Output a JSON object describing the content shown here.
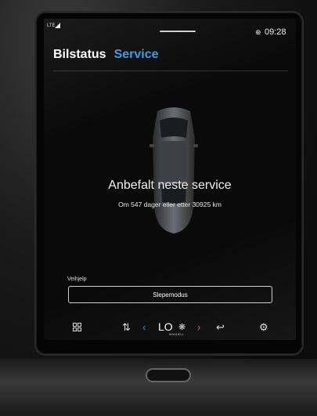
{
  "status_bar": {
    "network": "LTE",
    "time": "09:28"
  },
  "header": {
    "tabs": [
      {
        "label": "Bilstatus",
        "active": false
      },
      {
        "label": "Service",
        "active": true
      }
    ],
    "active_color": "#2f9be6"
  },
  "service": {
    "headline": "Anbefalt neste service",
    "detail": "Om 547 dager eller etter 30925 km"
  },
  "assist": {
    "section_label": "Veihjelp",
    "button_label": "Slepemodus"
  },
  "climate": {
    "temperature": "LO",
    "mode": "MANUELL",
    "icons": [
      "apps-grid-icon",
      "heated-seat-left-icon",
      "chevron-left-icon",
      "fan-icon",
      "chevron-right-icon",
      "heated-seat-right-icon",
      "settings-gear-icon"
    ]
  }
}
